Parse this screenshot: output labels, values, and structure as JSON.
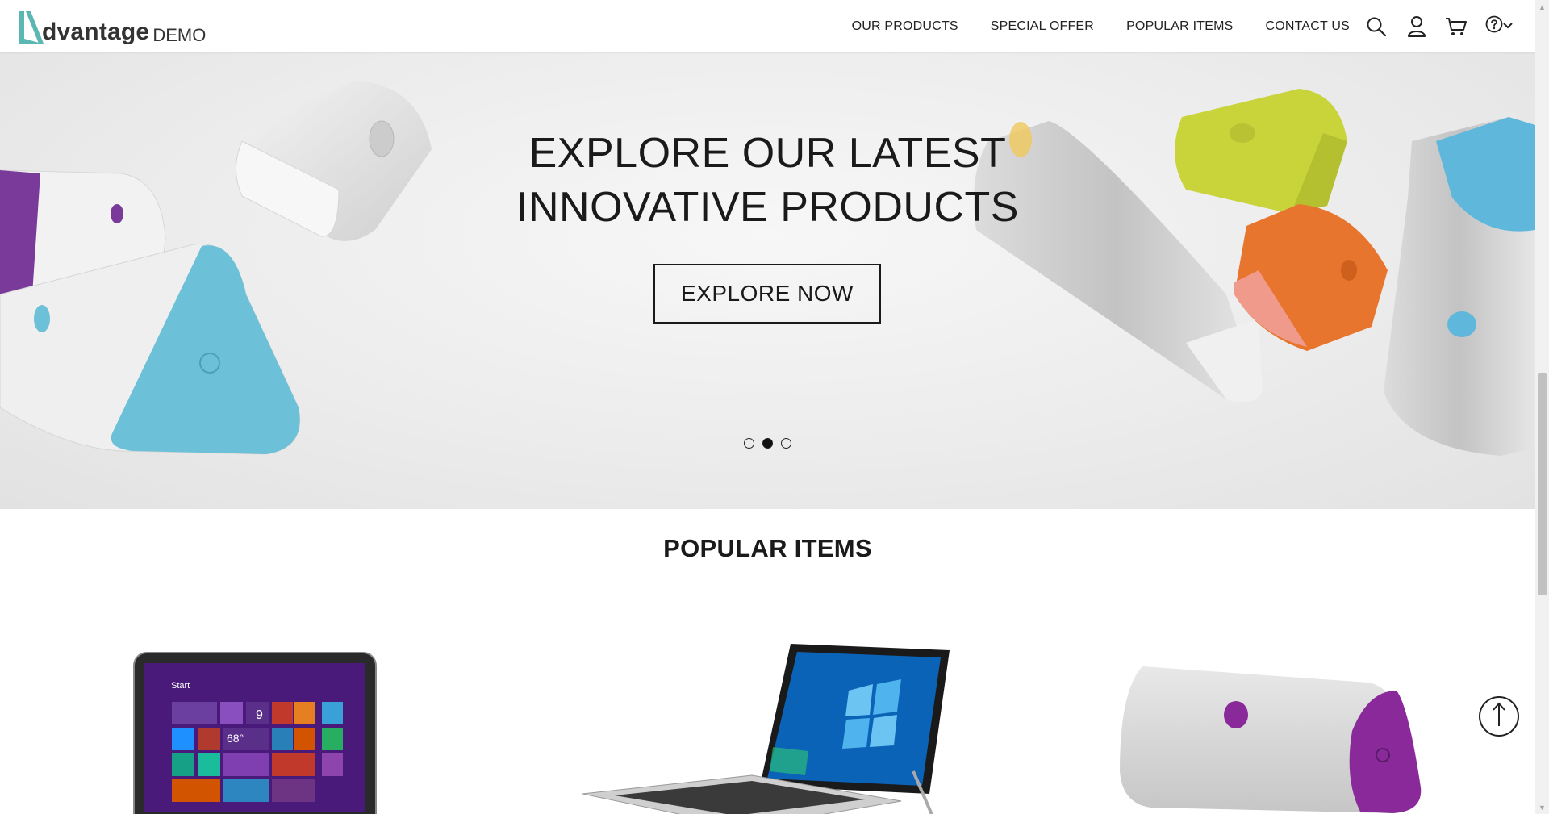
{
  "header": {
    "logo_text": "dvantage",
    "logo_suffix": "DEMO",
    "nav": [
      {
        "label": "OUR PRODUCTS"
      },
      {
        "label": "SPECIAL OFFER"
      },
      {
        "label": "POPULAR ITEMS"
      },
      {
        "label": "CONTACT US"
      }
    ],
    "icons": [
      "search-icon",
      "user-icon",
      "cart-icon",
      "help-icon",
      "chevron-down-icon"
    ]
  },
  "hero": {
    "title_line1": "EXPLORE OUR LATEST",
    "title_line2": "INNOVATIVE PRODUCTS",
    "button_label": "EXPLORE NOW",
    "slides_count": 3,
    "active_slide": 2
  },
  "popular": {
    "title": "POPULAR ITEMS",
    "tablet_screen": {
      "start": "Start",
      "temp": "68°",
      "date": "9"
    }
  },
  "colors": {
    "brand_teal": "#5ab7b2",
    "speaker_blue": "#6cc0d8",
    "speaker_purple": "#7a3a9a",
    "speaker_yellow": "#c9d43a",
    "speaker_orange": "#e8752e"
  }
}
